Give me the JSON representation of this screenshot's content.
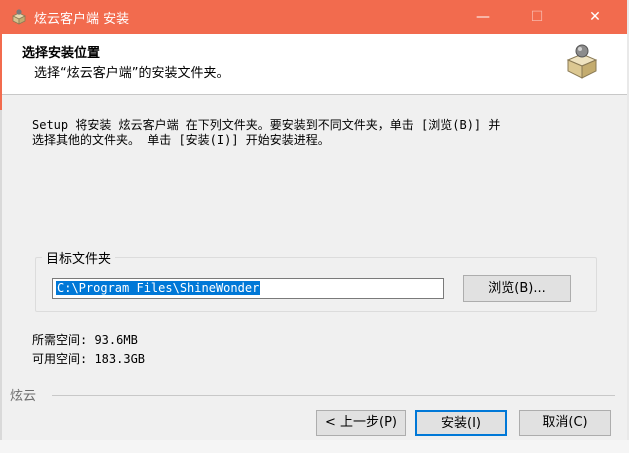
{
  "window": {
    "title": "炫云客户端 安装",
    "titlebar_color": "#f26b4e",
    "controls": {
      "minimize": "—",
      "maximize": "☐",
      "close": "✕"
    }
  },
  "header": {
    "title": "选择安装位置",
    "subtitle": "选择“炫云客户端”的安装文件夹。",
    "icon": "installer-package-icon"
  },
  "description": {
    "line1": "Setup 将安装 炫云客户端 在下列文件夹。要安装到不同文件夹，单击 [浏览(B)] 并",
    "line2": "选择其他的文件夹。 单击 [安装(I)] 开始安装进程。"
  },
  "destination": {
    "group_label": "目标文件夹",
    "path_value": "C:\\Program Files\\ShineWonder",
    "browse_label": "浏览(B)..."
  },
  "space": {
    "required": "所需空间: 93.6MB",
    "available": "可用空间: 183.3GB"
  },
  "footer": {
    "brand": "炫云",
    "back_label": "< 上一步(P)",
    "install_label": "安装(I)",
    "cancel_label": "取消(C)"
  },
  "accent_color": "#0078d7"
}
